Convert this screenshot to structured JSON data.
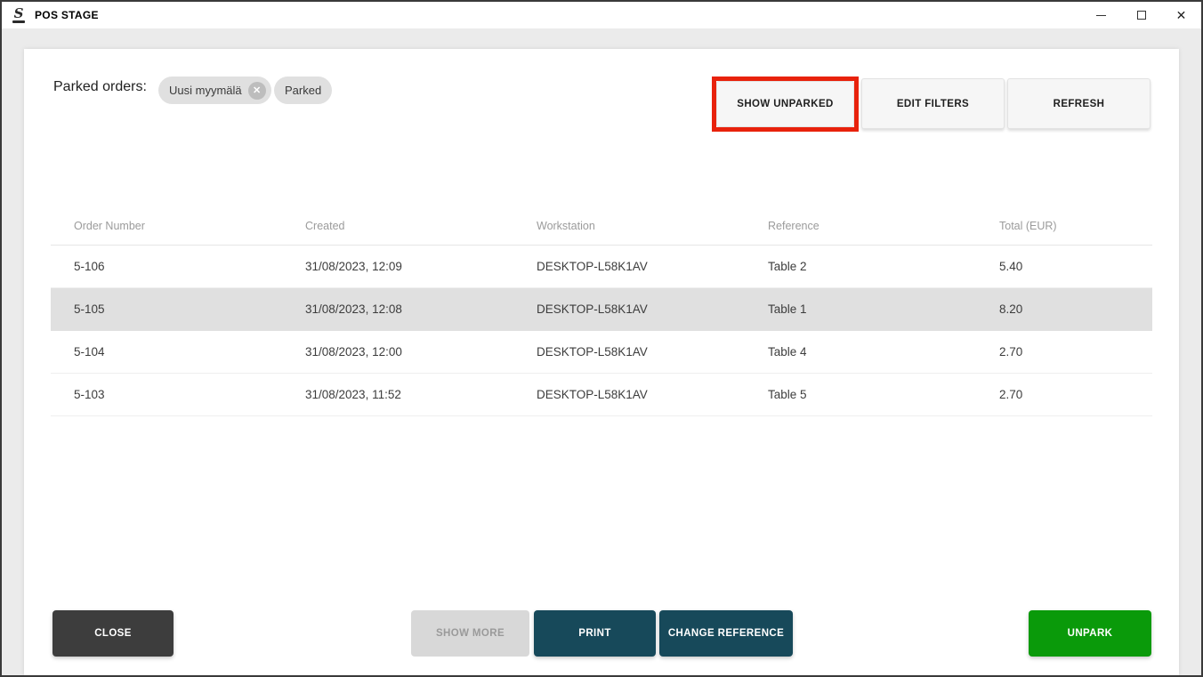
{
  "window": {
    "title": "POS STAGE"
  },
  "header": {
    "label": "Parked orders:",
    "chips": [
      {
        "label": "Uusi myymälä",
        "removable": true,
        "remove_glyph": "✕"
      },
      {
        "label": "Parked",
        "removable": false
      }
    ],
    "buttons": [
      {
        "label": "SHOW UNPARKED",
        "highlighted": true
      },
      {
        "label": "EDIT FILTERS",
        "highlighted": false
      },
      {
        "label": "REFRESH",
        "highlighted": false
      }
    ]
  },
  "table": {
    "columns": [
      "Order Number",
      "Created",
      "Workstation",
      "Reference",
      "Total (EUR)"
    ],
    "rows": [
      {
        "order_number": "5-106",
        "created": "31/08/2023, 12:09",
        "workstation": "DESKTOP-L58K1AV",
        "reference": "Table 2",
        "total": "5.40",
        "selected": false
      },
      {
        "order_number": "5-105",
        "created": "31/08/2023, 12:08",
        "workstation": "DESKTOP-L58K1AV",
        "reference": "Table 1",
        "total": "8.20",
        "selected": true
      },
      {
        "order_number": "5-104",
        "created": "31/08/2023, 12:00",
        "workstation": "DESKTOP-L58K1AV",
        "reference": "Table 4",
        "total": "2.70",
        "selected": false
      },
      {
        "order_number": "5-103",
        "created": "31/08/2023, 11:52",
        "workstation": "DESKTOP-L58K1AV",
        "reference": "Table 5",
        "total": "2.70",
        "selected": false
      }
    ]
  },
  "footer": {
    "close_label": "CLOSE",
    "show_more_label": "SHOW MORE",
    "print_label": "PRINT",
    "change_reference_label": "CHANGE REFERENCE",
    "unpark_label": "UNPARK"
  },
  "colors": {
    "teal_button": "#17495a",
    "green_button": "#0a9a0a",
    "dark_button": "#3d3d3d",
    "disabled_button": "#d8d8d8",
    "highlight_red": "#e8220c",
    "selected_row": "#e0e0e0",
    "chip_bg": "#e0e0e0",
    "body_bg": "#ebebeb"
  }
}
